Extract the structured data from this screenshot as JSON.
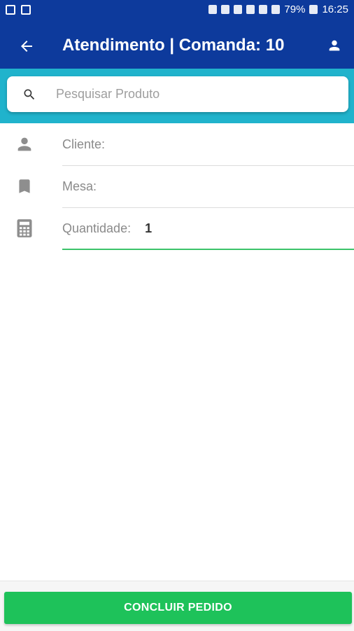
{
  "status_bar": {
    "battery": "79%",
    "time": "16:25"
  },
  "app_bar": {
    "title": "Atendimento | Comanda: 10",
    "back_icon": "arrow-back-icon",
    "user_icon": "person-icon"
  },
  "search": {
    "placeholder": "Pesquisar Produto",
    "value": ""
  },
  "fields": [
    {
      "label": "Cliente:",
      "value": "",
      "icon": "person-icon"
    },
    {
      "label": "Mesa:",
      "value": "",
      "icon": "bookmark-icon"
    },
    {
      "label": "Quantidade:",
      "value": "1",
      "icon": "calculator-icon"
    }
  ],
  "footer": {
    "submit_label": "CONCLUIR PEDIDO"
  },
  "colors": {
    "primary": "#0d3a9c",
    "search_band": "#20b3cc",
    "accent_green": "#1ec25a",
    "focus_line": "#3cc36a"
  }
}
